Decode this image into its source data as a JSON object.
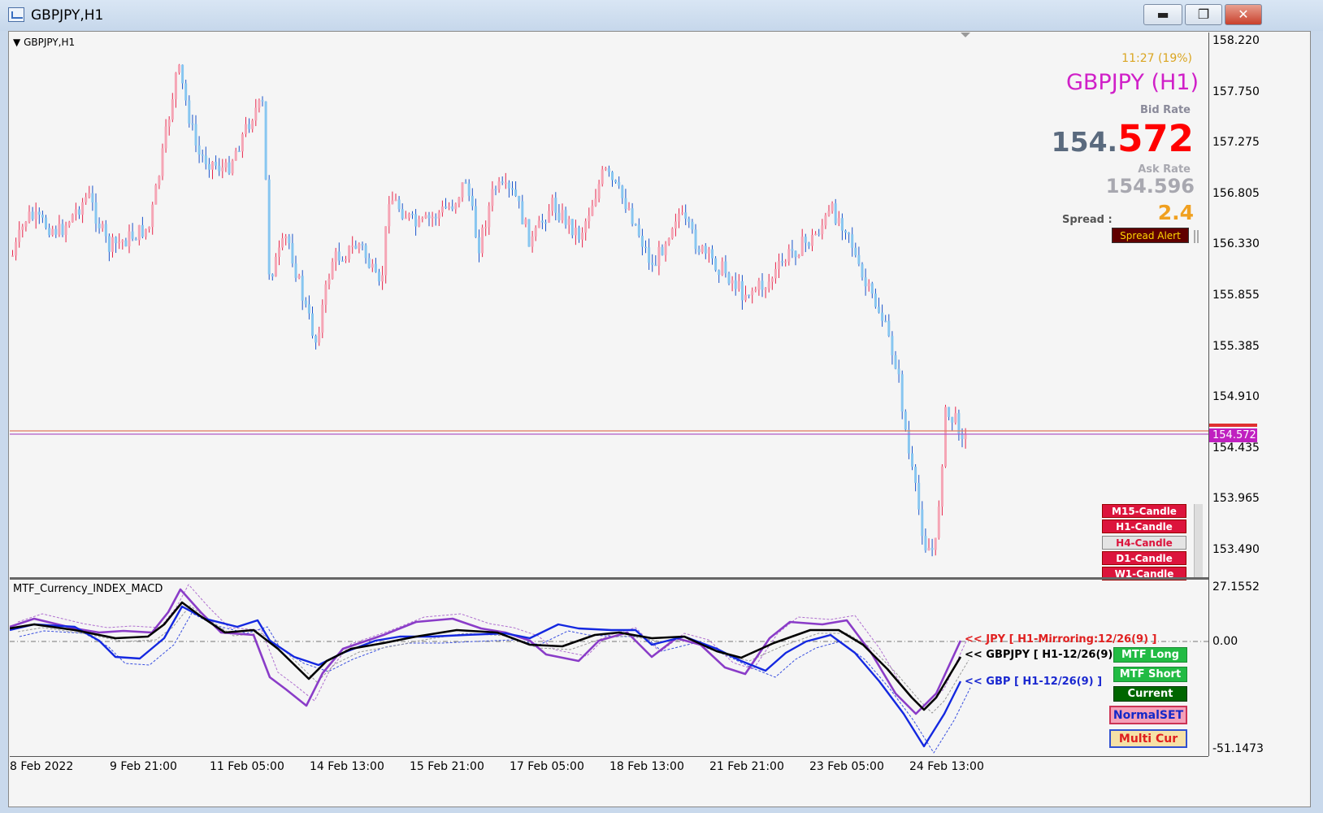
{
  "window": {
    "title": "GBPJPY,H1",
    "minimize_icon": "minimize-icon",
    "maximize_icon": "maximize-icon",
    "close_icon": "close-icon"
  },
  "chart": {
    "label": "GBPJPY,H1",
    "price_axis": [
      "158.220",
      "157.750",
      "157.275",
      "156.805",
      "156.330",
      "155.855",
      "155.385",
      "154.910",
      "154.435",
      "153.965",
      "153.490"
    ],
    "current_price_tag": "154.572",
    "time_axis": [
      "8 Feb 2022",
      "9 Feb 21:00",
      "11 Feb 05:00",
      "14 Feb 13:00",
      "15 Feb 21:00",
      "17 Feb 05:00",
      "18 Feb 13:00",
      "21 Feb 21:00",
      "23 Feb 05:00",
      "24 Feb 13:00"
    ],
    "bull_color": "#f5a5b5",
    "bear_color": "#87c6f0"
  },
  "info_panel": {
    "time": "11:27 (19%)",
    "symbol": "GBPJPY (H1)",
    "bid_label": "Bid Rate",
    "bid_int": "154.",
    "bid_frac": "572",
    "ask_label": "Ask Rate",
    "ask_value": "154.596",
    "spread_label": "Spread  :",
    "spread_value": "2.4",
    "spread_alert": "Spread Alert"
  },
  "candle_buttons": [
    "M15-Candle",
    "H1-Candle",
    "H4-Candle",
    "D1-Candle",
    "W1-Candle"
  ],
  "indicator": {
    "name": "MTF_Currency_INDEX_MACD",
    "axis": [
      "27.1552",
      "0.00",
      "-51.1473"
    ],
    "legend_jpy": "<< JPY [ H1-Mirroring:12/26(9) ]",
    "legend_pair": "<< GBPJPY [ H1-12/26(9) ]",
    "legend_gbp": "<< GBP [ H1-12/26(9) ]",
    "buttons": {
      "mtf_long": "MTF Long",
      "mtf_short": "MTF Short",
      "current": "Current",
      "normal_set": "NormalSET",
      "multi_cur": "Multi Cur"
    }
  }
}
